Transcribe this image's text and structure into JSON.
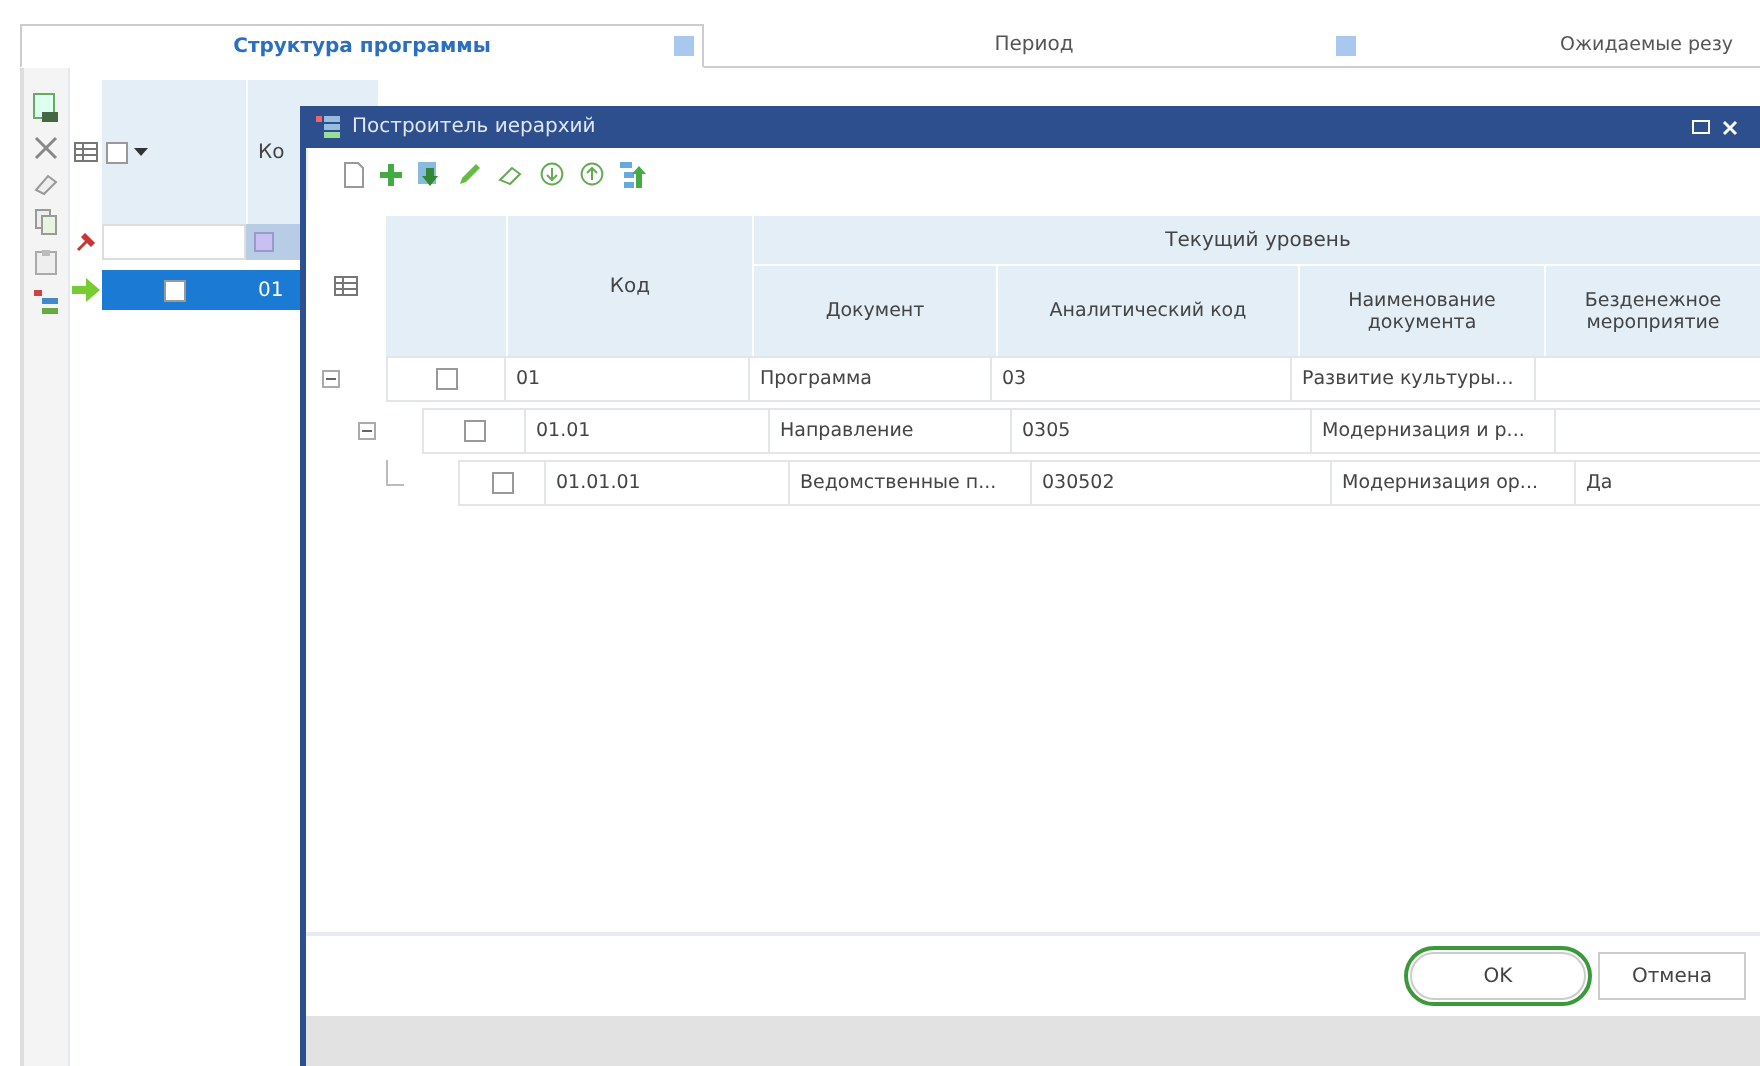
{
  "tabs": [
    {
      "label": "Структура программы",
      "selected": true
    },
    {
      "label": "Период",
      "selected": false
    },
    {
      "label": "Ожидаемые резу",
      "selected": false
    }
  ],
  "main_grid": {
    "column_header": "Ко",
    "select_all_checked": false,
    "rows": [
      {
        "code": "01",
        "selected": true,
        "checked": false
      }
    ]
  },
  "dialog": {
    "title": "Построитель иерархий",
    "columns": {
      "code": "Код",
      "group": "Текущий уровень",
      "sub": [
        "Документ",
        "Аналитический код",
        "Наименование документа",
        "Безденежное мероприятие"
      ]
    },
    "rows": [
      {
        "code": "01",
        "document": "Программа",
        "analytic_code": "03",
        "name": "Развитие культуры...",
        "checked": false,
        "expanded": true,
        "children": [
          {
            "code": "01.01",
            "document": "Направление",
            "analytic_code": "0305",
            "name": "Модернизация и р...",
            "checked": false,
            "expanded": true,
            "children": [
              {
                "code": "01.01.01",
                "document": "Ведомственные п...",
                "analytic_code": "030502",
                "name": "Модернизация ор...",
                "non_cash": "Да",
                "checked": false
              }
            ]
          }
        ]
      }
    ],
    "buttons": [
      {
        "label": "OK",
        "highlighted": true
      },
      {
        "label": "Отмена",
        "highlighted": false
      }
    ]
  }
}
